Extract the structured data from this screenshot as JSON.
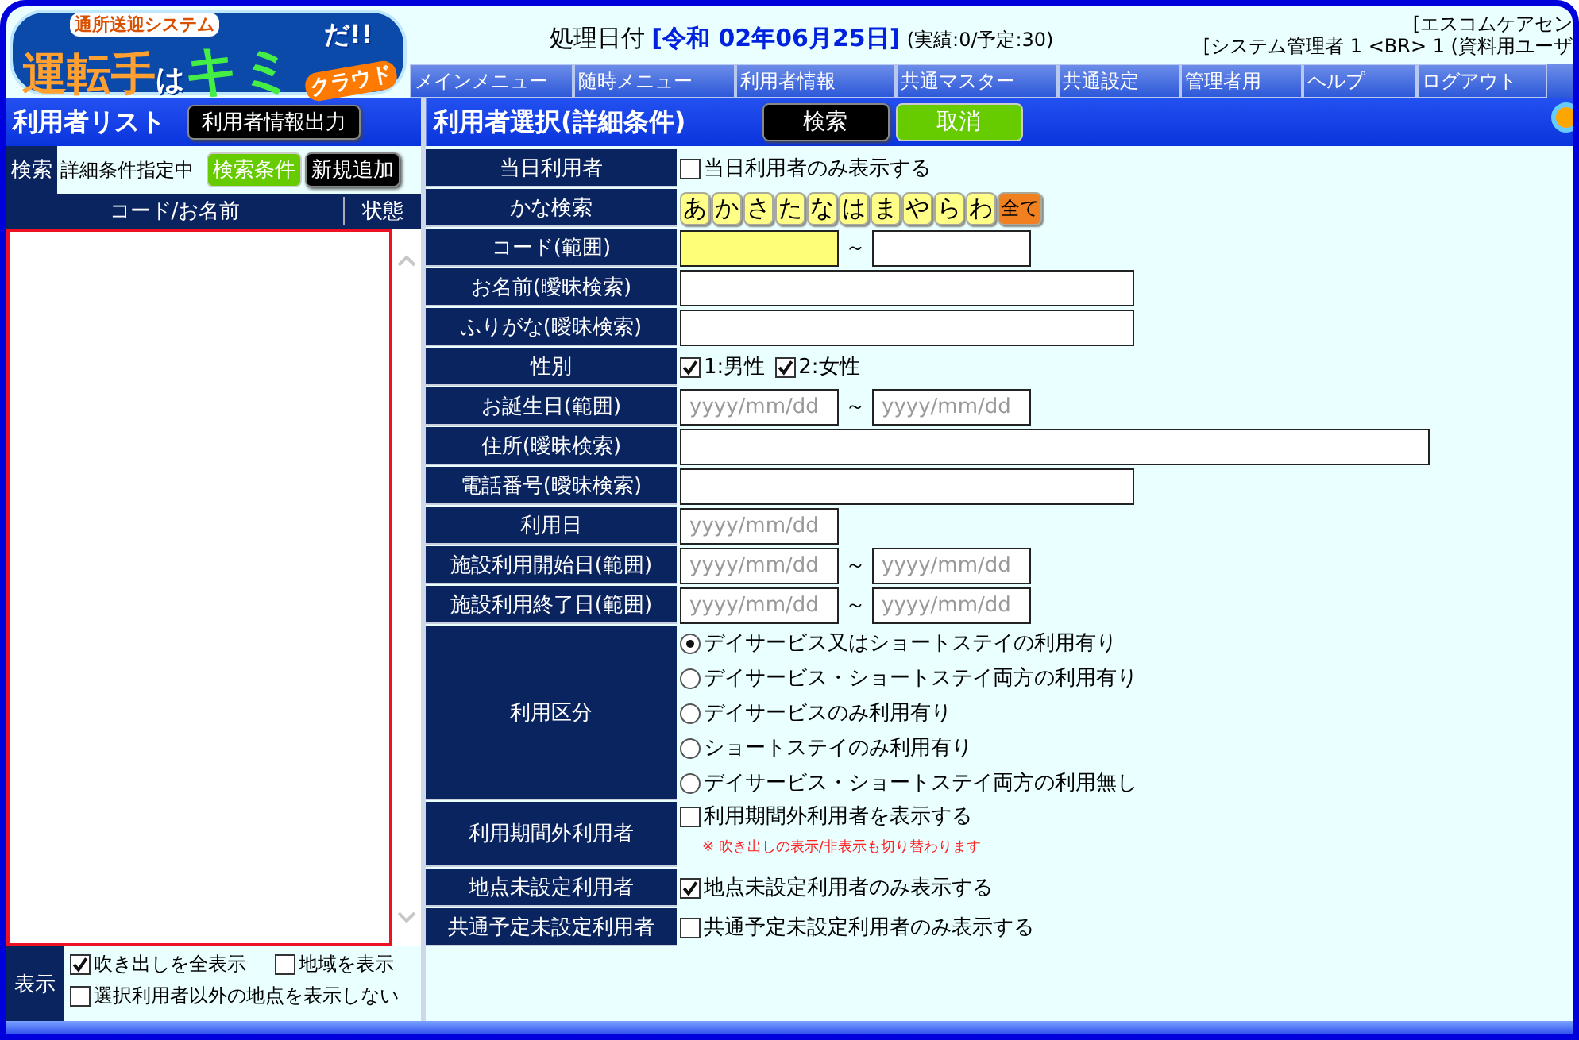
{
  "header": {
    "logo": {
      "tagline": "通所送迎システム",
      "title_main": "運転手",
      "title_particle": "は",
      "title_accent": "キミ",
      "title_end": "だ!!",
      "title_cloud": "クラウド"
    },
    "date_label": "処理日付",
    "date": "[令和 02年06月25日]",
    "counts": "(実績:0/予定:30)",
    "office": "[エスコムケアセン",
    "user": "[システム管理者 1 <BR> 1 (資料用ユーザ"
  },
  "menu": [
    "メインメニュー",
    "随時メニュー",
    "利用者情報",
    "共通マスター",
    "共通設定",
    "管理者用",
    "ヘルプ",
    "ログアウト"
  ],
  "left_panel": {
    "title": "利用者リスト",
    "export_button": "利用者情報出力",
    "search_label": "検索",
    "search_status": "詳細条件指定中",
    "conditions_button": "検索条件",
    "add_button": "新規追加",
    "columns": [
      "コード/お名前",
      "状態"
    ],
    "display_label": "表示",
    "display_options": [
      {
        "label": "吹き出しを全表示",
        "checked": true
      },
      {
        "label": "地域を表示",
        "checked": false
      },
      {
        "label": "選択利用者以外の地点を表示しない",
        "checked": false
      }
    ]
  },
  "right_panel": {
    "title": "利用者選択(詳細条件)",
    "search_button": "検索",
    "cancel_button": "取消",
    "rows": [
      {
        "label": "当日利用者",
        "kind": "checkbox",
        "options": [
          {
            "label": "当日利用者のみ表示する",
            "checked": false
          }
        ]
      },
      {
        "label": "かな検索",
        "kind": "kana",
        "keys": [
          {
            "label": "あ",
            "selected": false
          },
          {
            "label": "か",
            "selected": false
          },
          {
            "label": "さ",
            "selected": false
          },
          {
            "label": "た",
            "selected": false
          },
          {
            "label": "な",
            "selected": false
          },
          {
            "label": "は",
            "selected": false
          },
          {
            "label": "ま",
            "selected": false
          },
          {
            "label": "や",
            "selected": false
          },
          {
            "label": "ら",
            "selected": false
          },
          {
            "label": "わ",
            "selected": false
          },
          {
            "label": "全て",
            "selected": true
          }
        ]
      },
      {
        "label": "コード(範囲)",
        "kind": "range",
        "separator": "～",
        "fields": [
          {
            "focused": true
          },
          {
            "focused": false
          }
        ]
      },
      {
        "label": "お名前(曖昧検索)",
        "kind": "text"
      },
      {
        "label": "ふりがな(曖昧検索)",
        "kind": "text"
      },
      {
        "label": "性別",
        "kind": "checkbox",
        "options": [
          {
            "label": "1:男性",
            "checked": true
          },
          {
            "label": "2:女性",
            "checked": true
          }
        ]
      },
      {
        "label": "お誕生日(範囲)",
        "kind": "range",
        "separator": "～",
        "fields": [
          {
            "placeholder": "yyyy/mm/dd",
            "focused": false
          },
          {
            "placeholder": "yyyy/mm/dd",
            "focused": false
          }
        ]
      },
      {
        "label": "住所(曖昧検索)",
        "kind": "long_text"
      },
      {
        "label": "電話番号(曖昧検索)",
        "kind": "text"
      },
      {
        "label": "利用日",
        "kind": "date",
        "placeholder": "yyyy/mm/dd"
      },
      {
        "label": "施設利用開始日(範囲)",
        "kind": "range",
        "separator": "～",
        "fields": [
          {
            "placeholder": "yyyy/mm/dd",
            "focused": false
          },
          {
            "placeholder": "yyyy/mm/dd",
            "focused": false
          }
        ]
      },
      {
        "label": "施設利用終了日(範囲)",
        "kind": "range",
        "separator": "～",
        "fields": [
          {
            "placeholder": "yyyy/mm/dd",
            "focused": false
          },
          {
            "placeholder": "yyyy/mm/dd",
            "focused": false
          }
        ]
      },
      {
        "label": "利用区分",
        "kind": "radio",
        "options": [
          {
            "label": "デイサービス又はショートステイの利用有り",
            "selected": true
          },
          {
            "label": "デイサービス・ショートステイ両方の利用有り",
            "selected": false
          },
          {
            "label": "デイサービスのみ利用有り",
            "selected": false
          },
          {
            "label": "ショートステイのみ利用有り",
            "selected": false
          },
          {
            "label": "デイサービス・ショートステイ両方の利用無し",
            "selected": false
          }
        ]
      },
      {
        "label": "利用期間外利用者",
        "kind": "checkbox",
        "options": [
          {
            "label": "利用期間外利用者を表示する",
            "checked": false
          }
        ],
        "note": "※ 吹き出しの表示/非表示も切り替わります"
      },
      {
        "label": "地点未設定利用者",
        "kind": "checkbox",
        "options": [
          {
            "label": "地点未設定利用者のみ表示する",
            "checked": true
          }
        ]
      },
      {
        "label": "共通予定未設定利用者",
        "kind": "checkbox",
        "options": [
          {
            "label": "共通予定未設定利用者のみ表示する",
            "checked": false
          }
        ]
      }
    ]
  }
}
